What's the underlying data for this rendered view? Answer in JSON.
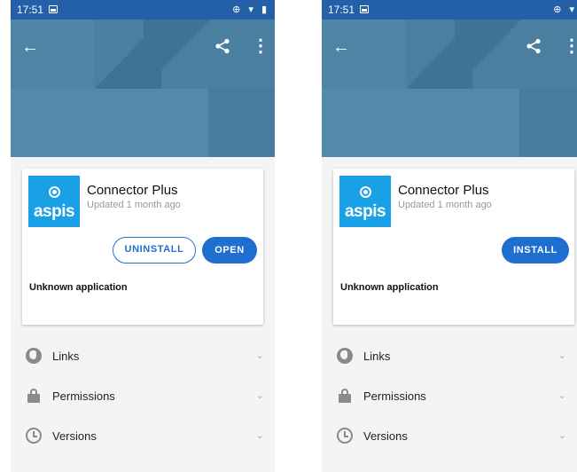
{
  "screens": [
    {
      "status": {
        "time": "17:51",
        "icons": "⊕ ▾ ▮"
      },
      "app": {
        "name": "Connector Plus",
        "updated": "Updated 1 month ago",
        "logo_text": "aspis"
      },
      "buttons": {
        "uninstall": "UNINSTALL",
        "open": "OPEN"
      },
      "unknown": "Unknown application",
      "sections": [
        {
          "label": "Links"
        },
        {
          "label": "Permissions"
        },
        {
          "label": "Versions"
        }
      ]
    },
    {
      "status": {
        "time": "17:51",
        "icons": "⊕ ▾"
      },
      "app": {
        "name": "Connector Plus",
        "updated": "Updated 1 month ago",
        "logo_text": "aspis"
      },
      "buttons": {
        "install": "INSTALL"
      },
      "unknown": "Unknown application",
      "sections": [
        {
          "label": "Links"
        },
        {
          "label": "Permissions"
        },
        {
          "label": "Versions"
        }
      ]
    }
  ],
  "colors": {
    "accent": "#1f6fd1",
    "header": "#4a7f9f",
    "statusbar": "#2360a8",
    "logo_bg": "#1aa0e6"
  },
  "icons": {
    "back": "arrow-left-icon",
    "share": "share-icon",
    "more": "more-vert-icon",
    "links": "globe-icon",
    "permissions": "lock-icon",
    "versions": "clock-icon",
    "expand": "chevron-down-icon"
  }
}
